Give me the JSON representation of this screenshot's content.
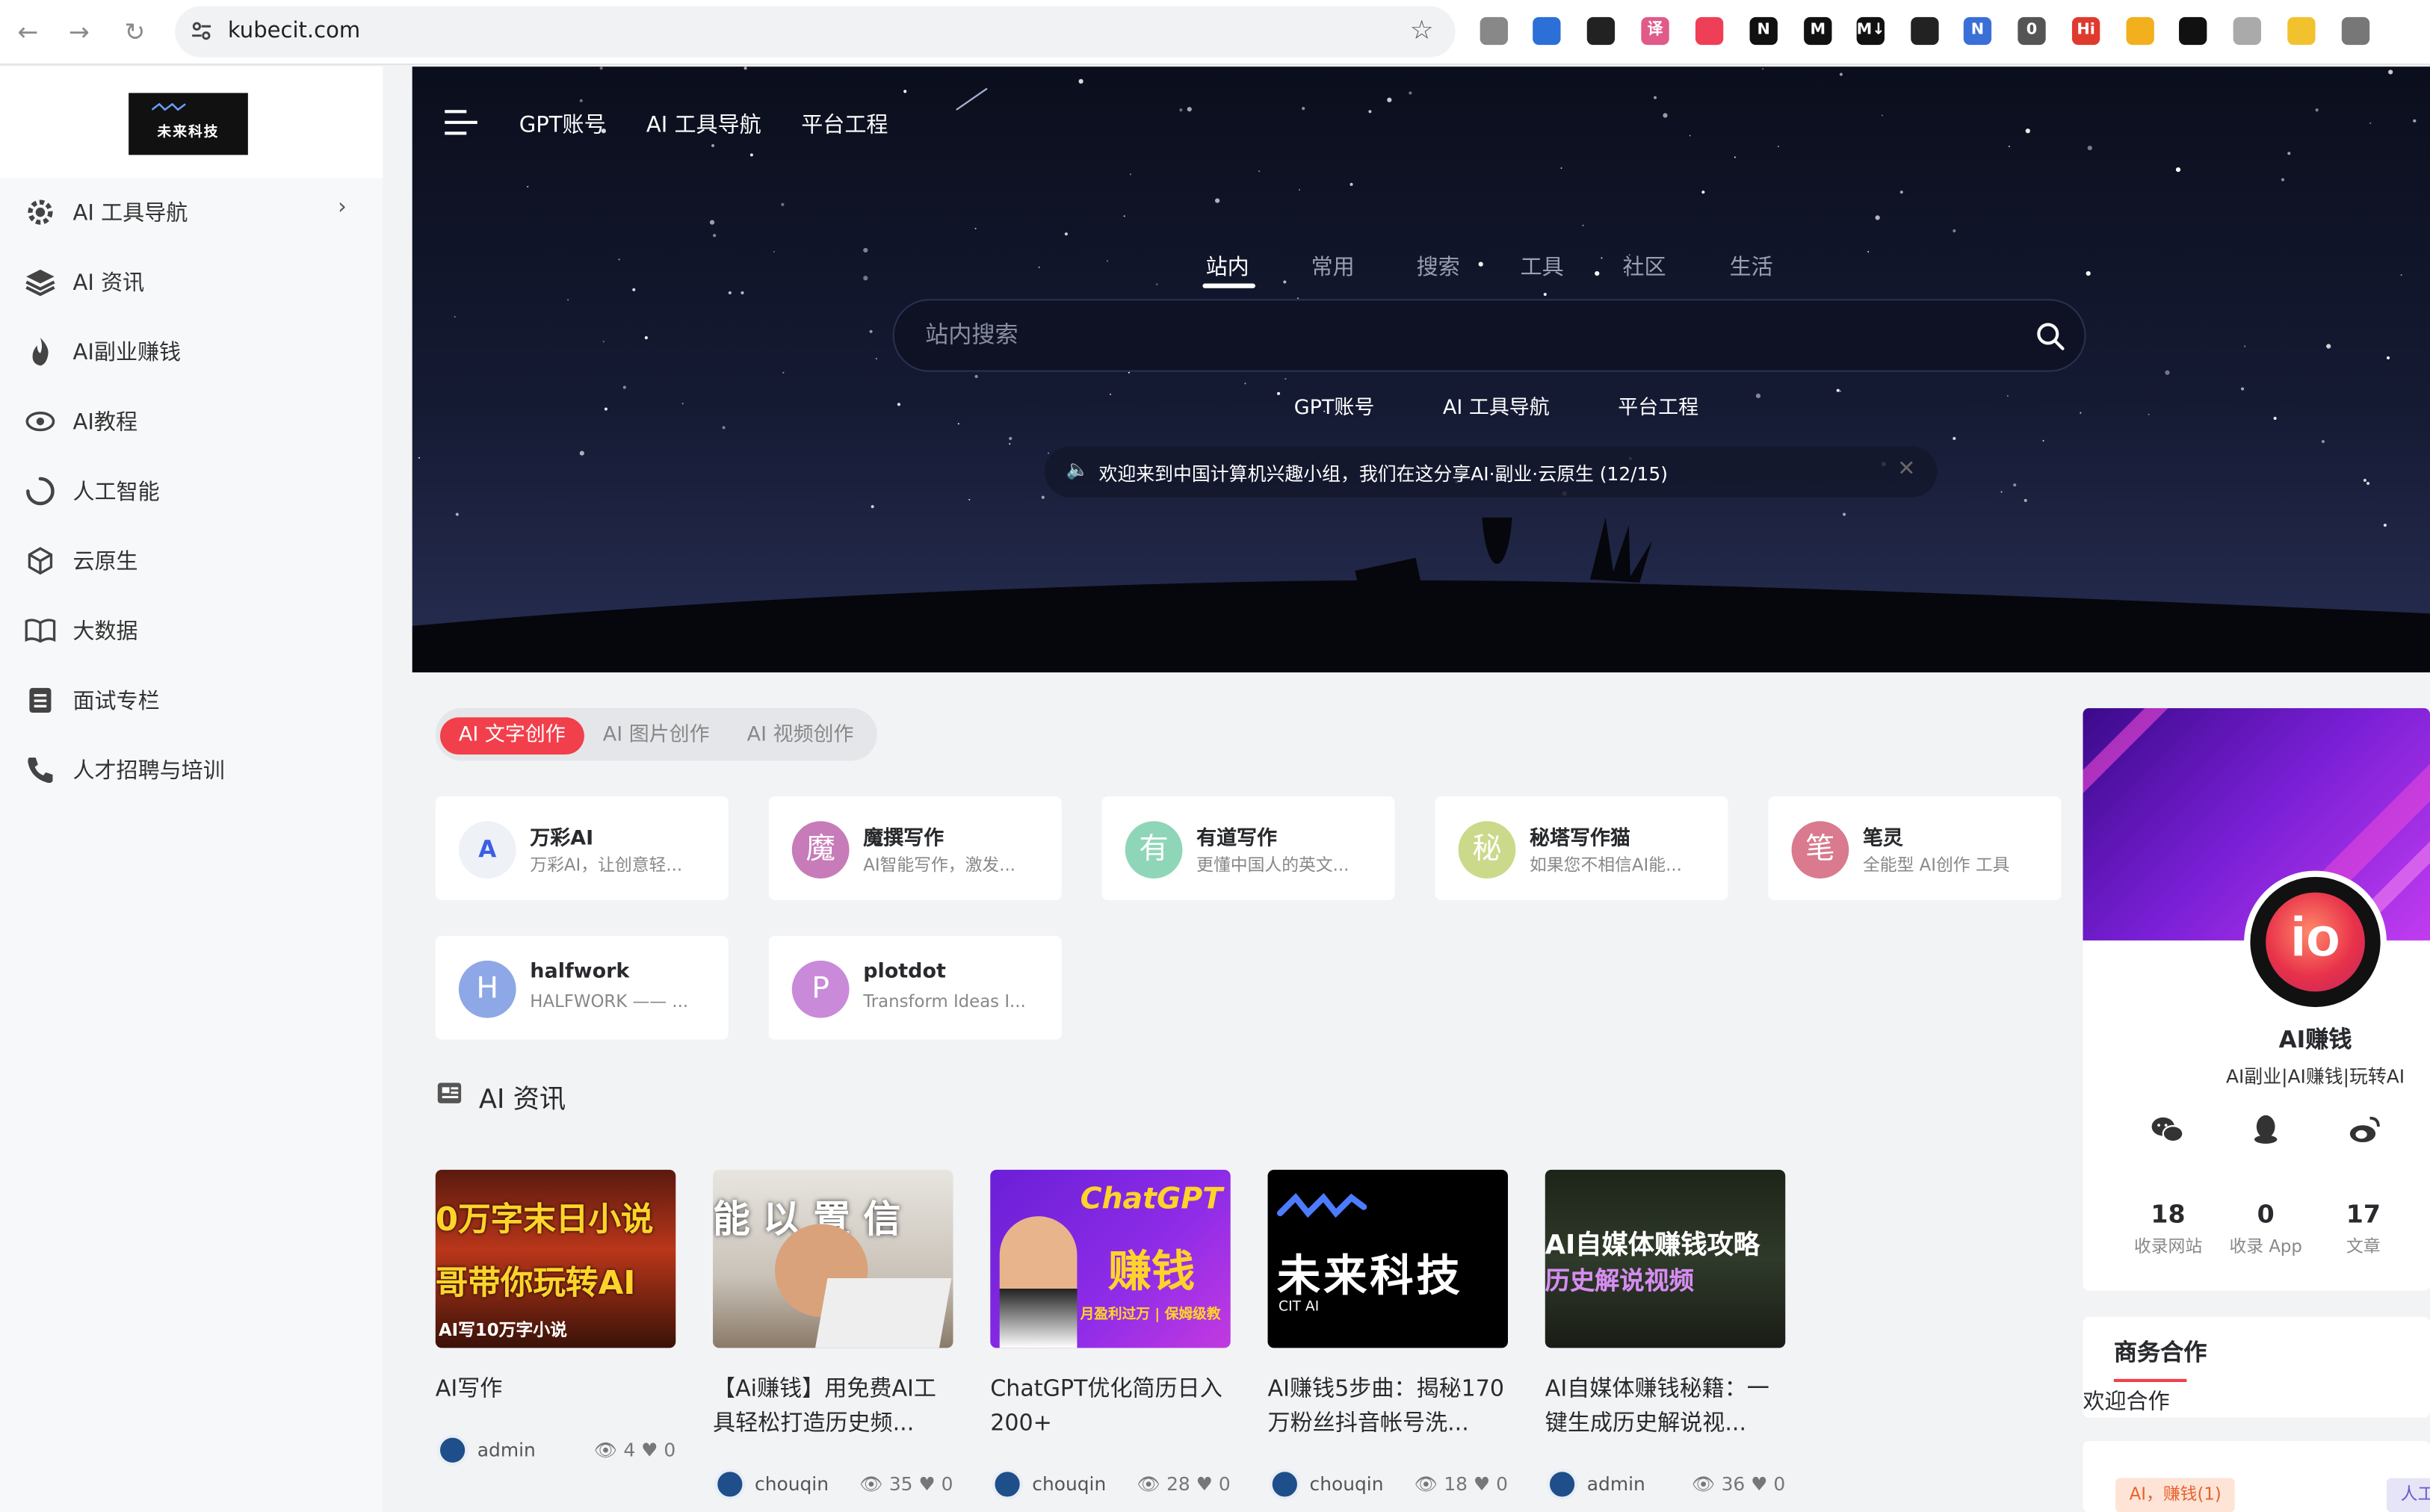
{
  "browser": {
    "url": "kubecit.com",
    "extensions": [
      {
        "name": "power-ext-icon",
        "color": "#888888",
        "label": ""
      },
      {
        "name": "highlighter-ext-icon",
        "color": "#2c6fd6",
        "label": ""
      },
      {
        "name": "card-ext-icon",
        "color": "#222222",
        "label": ""
      },
      {
        "name": "translate-ext-icon",
        "color": "#e05a8a",
        "label": "译"
      },
      {
        "name": "pocket-ext-icon",
        "color": "#ef3f56",
        "label": ""
      },
      {
        "name": "notion-ext-icon",
        "color": "#111111",
        "label": "N"
      },
      {
        "name": "medium-ext-icon",
        "color": "#111111",
        "label": "M"
      },
      {
        "name": "markdown-ext-icon",
        "color": "#111111",
        "label": "M↓"
      },
      {
        "name": "eyedropper-ext-icon",
        "color": "#222222",
        "label": ""
      },
      {
        "name": "n-ext-icon",
        "color": "#3a6fd8",
        "label": "N"
      },
      {
        "name": "sync-ext-icon",
        "color": "#555555",
        "label": "0"
      },
      {
        "name": "hi-ext-icon",
        "color": "#e03a2f",
        "label": "Hi"
      },
      {
        "name": "yellow-ext-icon",
        "color": "#f2b01e",
        "label": ""
      },
      {
        "name": "glasses-ext-icon",
        "color": "#111111",
        "label": ""
      },
      {
        "name": "a-ext-icon",
        "color": "#aaaaaa",
        "label": ""
      },
      {
        "name": "note-ext-icon",
        "color": "#f2c12e",
        "label": ""
      },
      {
        "name": "puzzle-ext-icon",
        "color": "#777777",
        "label": ""
      }
    ]
  },
  "logo": {
    "text": "未来科技",
    "sub": "CIT AI"
  },
  "sidebar": {
    "items": [
      {
        "label": "AI 工具导航",
        "icon": "gear-icon",
        "has_submenu": true
      },
      {
        "label": "AI 资讯",
        "icon": "layers-icon",
        "has_submenu": false
      },
      {
        "label": "AI副业赚钱",
        "icon": "fire-icon",
        "has_submenu": false
      },
      {
        "label": "AI教程",
        "icon": "eye-icon",
        "has_submenu": false
      },
      {
        "label": "人工智能",
        "icon": "spinner-icon",
        "has_submenu": false
      },
      {
        "label": "云原生",
        "icon": "cube-icon",
        "has_submenu": false
      },
      {
        "label": "大数据",
        "icon": "book-icon",
        "has_submenu": false
      },
      {
        "label": "面试专栏",
        "icon": "document-icon",
        "has_submenu": false
      },
      {
        "label": "人才招聘与培训",
        "icon": "phone-icon",
        "has_submenu": false
      }
    ]
  },
  "header": {
    "nav": [
      "GPT账号",
      "AI 工具导航",
      "平台工程"
    ]
  },
  "search": {
    "tabs": [
      "站内",
      "常用",
      "搜索",
      "工具",
      "社区",
      "生活"
    ],
    "active_tab": "站内",
    "placeholder": "站内搜索",
    "quick_links": [
      "GPT账号",
      "AI 工具导航",
      "平台工程"
    ]
  },
  "notice": {
    "text": "欢迎来到中国计算机兴趣小组，我们在这分享AI·副业·云原生 (12/15)"
  },
  "categories": {
    "tabs": [
      "AI 文字创作",
      "AI 图片创作",
      "AI 视频创作"
    ],
    "active": "AI 文字创作"
  },
  "tools": [
    {
      "name": "万彩AI",
      "desc": "万彩AI，让创意轻...",
      "avatar": "A",
      "color": "#eef1f6"
    },
    {
      "name": "魔撰写作",
      "desc": "AI智能写作，激发...",
      "avatar": "魔",
      "color": "#c77bb8"
    },
    {
      "name": "有道写作",
      "desc": "更懂中国人的英文...",
      "avatar": "有",
      "color": "#8fd6b8"
    },
    {
      "name": "秘塔写作猫",
      "desc": "如果您不相信AI能...",
      "avatar": "秘",
      "color": "#cbd98a"
    },
    {
      "name": "笔灵",
      "desc": "全能型 AI创作 工具",
      "avatar": "笔",
      "color": "#d97a8e"
    },
    {
      "name": "halfwork",
      "desc": "HALFWORK —— ...",
      "avatar": "H",
      "color": "#8ea7e6"
    },
    {
      "name": "plotdot",
      "desc": "Transform Ideas I...",
      "avatar": "P",
      "color": "#c98ad9"
    }
  ],
  "news": {
    "title": "AI 资讯",
    "cards": [
      {
        "title": "AI写作",
        "author": "admin",
        "views": "4",
        "likes": "0",
        "thumb_lines": [
          "0万字末日小说",
          "哥带你玩转AI",
          "AI写10万字小说"
        ]
      },
      {
        "title": "【Ai赚钱】用免费AI工具轻松打造历史频...",
        "author": "chouqin",
        "views": "35",
        "likes": "0",
        "thumb_lines": [
          "能 以 置 信"
        ]
      },
      {
        "title": "ChatGPT优化简历日入200+",
        "author": "chouqin",
        "views": "28",
        "likes": "0",
        "thumb_lines": [
          "ChatGPT +",
          "赚钱",
          "月盈利过万 | 保姆级教"
        ]
      },
      {
        "title": "AI赚钱5步曲：揭秘170万粉丝抖音帐号洗...",
        "author": "chouqin",
        "views": "18",
        "likes": "0",
        "thumb_lines": [
          "未来科技",
          "CIT AI"
        ]
      },
      {
        "title": "AI自媒体赚钱秘籍：一键生成历史解说视...",
        "author": "admin",
        "views": "36",
        "likes": "0",
        "thumb_lines": [
          "AI自媒体赚钱攻略",
          "历史解说视频"
        ]
      }
    ]
  },
  "profile": {
    "avatar_text": "io",
    "name": "AI赚钱",
    "tagline": "AI副业|AI赚钱|玩转AI",
    "social": [
      "wechat-icon",
      "qq-icon",
      "weibo-icon"
    ],
    "stats": [
      {
        "value": "18",
        "label": "收录网站"
      },
      {
        "value": "0",
        "label": "收录 App"
      },
      {
        "value": "17",
        "label": "文章"
      }
    ]
  },
  "business": {
    "title": "商务合作",
    "text": "欢迎合作"
  },
  "tags": [
    "AI，赚钱(1)",
    "人工"
  ]
}
